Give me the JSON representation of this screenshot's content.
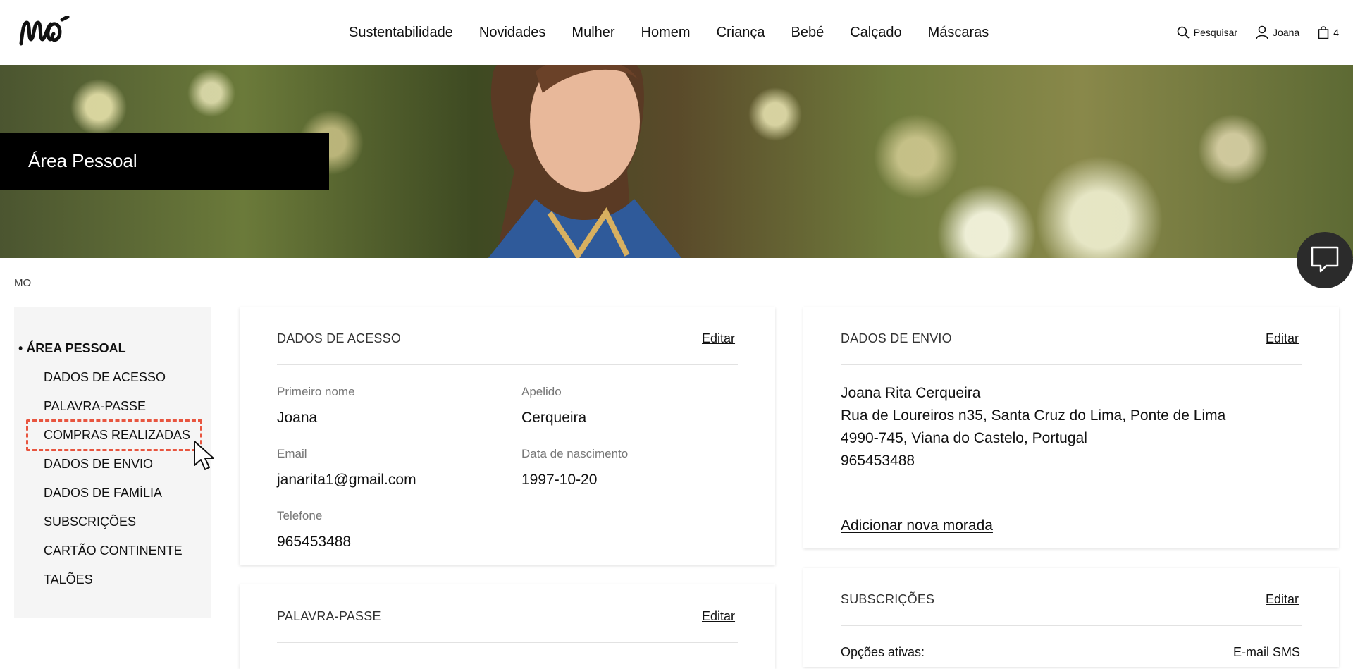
{
  "brand": {
    "logo_text": "mo"
  },
  "nav": {
    "items": [
      "Sustentabilidade",
      "Novidades",
      "Mulher",
      "Homem",
      "Criança",
      "Bebé",
      "Calçado",
      "Máscaras"
    ]
  },
  "header": {
    "search_label": "Pesquisar",
    "user_label": "Joana",
    "cart_count": "4"
  },
  "hero": {
    "title": "Área Pessoal"
  },
  "breadcrumb": "MO",
  "sidebar": {
    "active": "ÁREA PESSOAL",
    "items": [
      "DADOS DE ACESSO",
      "PALAVRA-PASSE",
      "COMPRAS REALIZADAS",
      "DADOS DE ENVIO",
      "DADOS DE FAMÍLIA",
      "SUBSCRIÇÕES",
      "CARTÃO CONTINENTE",
      "TALÕES"
    ]
  },
  "access": {
    "title": "DADOS DE ACESSO",
    "edit": "Editar",
    "first_name_label": "Primeiro nome",
    "first_name": "Joana",
    "last_name_label": "Apelido",
    "last_name": "Cerqueira",
    "email_label": "Email",
    "email": "janarita1@gmail.com",
    "birth_label": "Data de nascimento",
    "birth": "1997-10-20",
    "phone_label": "Telefone",
    "phone": "965453488"
  },
  "password": {
    "title": "PALAVRA-PASSE",
    "edit": "Editar"
  },
  "shipping": {
    "title": "DADOS DE ENVIO",
    "edit": "Editar",
    "lines": [
      "Joana Rita Cerqueira",
      "Rua de Loureiros n35, Santa Cruz do Lima, Ponte de Lima",
      "4990-745, Viana do Castelo, Portugal",
      "965453488"
    ],
    "add_address": "Adicionar nova morada"
  },
  "subscriptions": {
    "title": "SUBSCRIÇÕES",
    "edit": "Editar",
    "active_label": "Opções ativas:",
    "active_value": "E-mail SMS"
  }
}
